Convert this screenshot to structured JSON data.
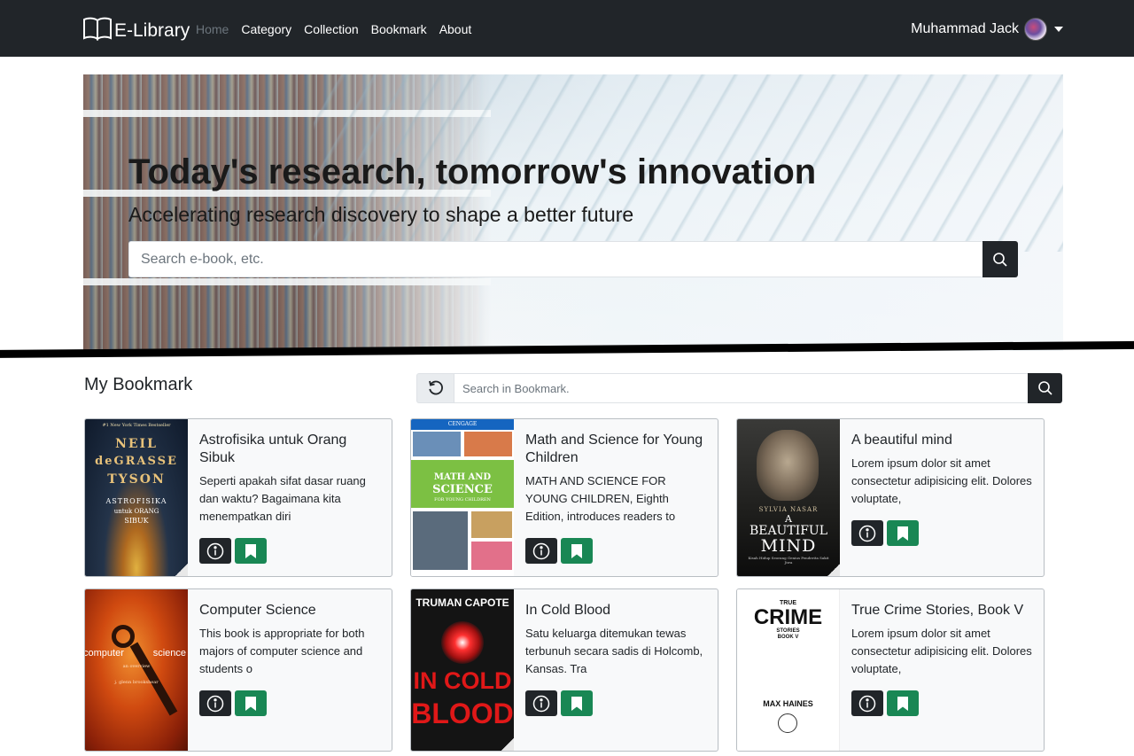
{
  "navbar": {
    "brand": "E-Library",
    "links": [
      "Home",
      "Category",
      "Collection",
      "Bookmark",
      "About"
    ],
    "active_link": "Home",
    "user_name": "Muhammad Jack"
  },
  "hero": {
    "title": "Today's research, tomorrow's innovation",
    "subtitle": "Accelerating research discovery to shape a better future",
    "search_placeholder": "Search e-book, etc."
  },
  "bookmark": {
    "title": "My Bookmark",
    "search_placeholder": "Search in Bookmark.",
    "cards": [
      {
        "title": "Astrofisika untuk Orang Sibuk",
        "description": "Seperti apakah sifat dasar ruang dan waktu? Bagaimana kita menempatkan diri",
        "cover": {
          "top_small": "#1 New York Times Bestseller",
          "line1": "NEIL",
          "line2": "deGRASSE",
          "line3": "TYSON",
          "line4": "ASTROFISIKA",
          "line5": "untuk ORANG",
          "line6": "SIBUK"
        }
      },
      {
        "title": "Math and Science for Young Children",
        "description": "MATH AND SCIENCE FOR YOUNG CHILDREN, Eighth Edition, introduces readers to",
        "cover": {
          "publisher": "CENGAGE",
          "line1": "MATH AND",
          "line2": "SCIENCE",
          "line3": "FOR YOUNG CHILDREN"
        }
      },
      {
        "title": "A beautiful mind",
        "description": "Lorem ipsum dolor sit amet consectetur adipisicing elit. Dolores voluptate,",
        "cover": {
          "author": "SYLVIA NASAR",
          "line1": "A",
          "line2": "BEAUTIFUL",
          "line3": "MIND",
          "line4": "Kisah Hidup Seorang Genius Penderita Sakit Jiwa"
        }
      },
      {
        "title": "Computer Science",
        "description": "This book is appropriate for both majors of computer science and students o",
        "cover": {
          "line1": "computer",
          "line2": "science",
          "line3": "an overview",
          "line4": "j. glenn brookshear"
        }
      },
      {
        "title": "In Cold Blood",
        "description": "Satu keluarga ditemukan tewas terbunuh secara sadis di Holcomb, Kansas. Tra",
        "cover": {
          "author": "TRUMAN CAPOTE",
          "line1": "IN COLD",
          "line2": "BLOOD"
        }
      },
      {
        "title": "True Crime Stories, Book V",
        "description": "Lorem ipsum dolor sit amet consectetur adipisicing elit. Dolores voluptate,",
        "cover": {
          "line1": "TRUE",
          "line2": "CRIME",
          "line3": "STORIES",
          "line4": "BOOK V",
          "author": "MAX HAINES"
        }
      }
    ]
  },
  "colors": {
    "navbar_bg": "#212529",
    "bookmark_button": "#198754",
    "info_button": "#212529"
  }
}
